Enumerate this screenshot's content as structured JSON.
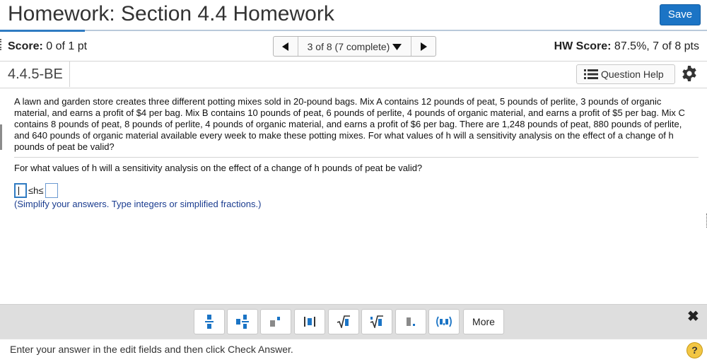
{
  "header": {
    "title": "Homework: Section 4.4 Homework",
    "save_label": "Save"
  },
  "scorebar": {
    "score_label": "Score:",
    "score_value": "0 of 1 pt",
    "nav_status": "3 of 8 (7 complete)",
    "hw_score_label": "HW Score:",
    "hw_score_value": "87.5%, 7 of 8 pts"
  },
  "question": {
    "id": "4.4.5-BE",
    "help_label": "Question Help",
    "problem_text": "A lawn and garden store creates three different potting mixes sold in 20-pound bags. Mix A contains 12 pounds of peat, 5 pounds of perlite, 3 pounds of organic material, and earns a profit of $4 per bag. Mix B contains 10 pounds of peat, 6 pounds of perlite, 4 pounds of organic material, and earns a profit of $5 per bag. Mix C contains 8 pounds of peat, 8 pounds of perlite, 4 pounds of organic material, and earns a profit of $6 per bag. There are 1,248 pounds of peat, 880 pounds of perlite, and 640 pounds of organic material available every week to make these potting mixes. For what values of h will a sensitivity analysis on the effect of a change of h pounds of peat be valid?",
    "prompt": "For what values of h will a sensitivity analysis on the effect of a change of h pounds of peat be valid?",
    "inequality_middle": "≤h≤",
    "lower_value": "",
    "upper_value": "",
    "hint": "(Simplify your answers. Type integers or simplified fractions.)"
  },
  "mathbar": {
    "buttons": [
      "fraction",
      "mixed-number",
      "exponent",
      "absolute-value",
      "square-root",
      "nth-root",
      "decimal",
      "ordered-pair"
    ],
    "more_label": "More",
    "close_symbol": "✖"
  },
  "footer": {
    "instruction": "Enter your answer in the edit fields and then click Check Answer.",
    "help_symbol": "?"
  },
  "colors": {
    "accent": "#1b74c5",
    "hint_text": "#1a3c8f",
    "input_border": "#2f7bc2",
    "help_badge": "#f2c644"
  }
}
